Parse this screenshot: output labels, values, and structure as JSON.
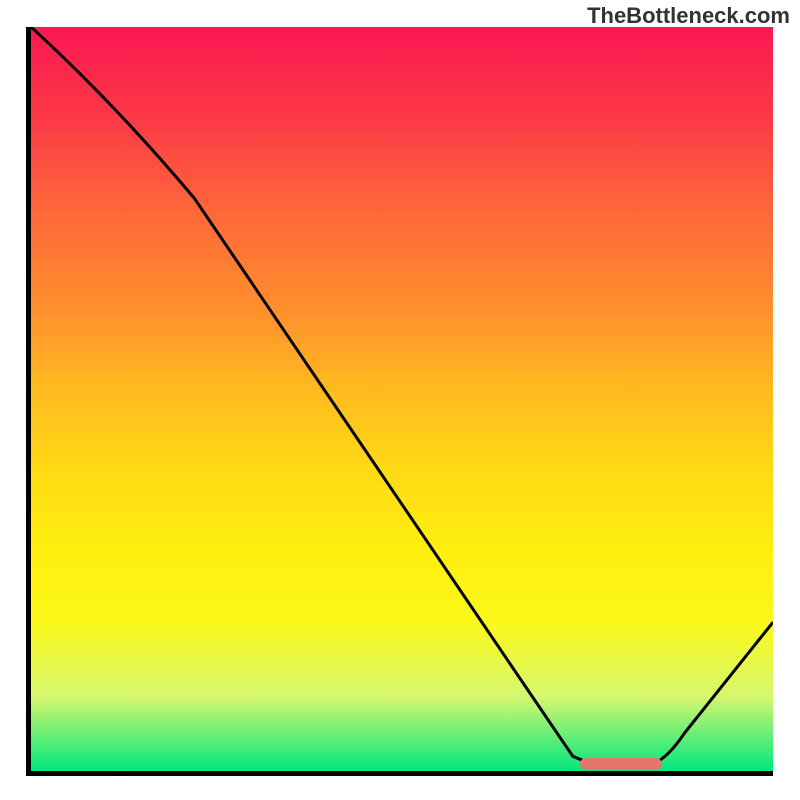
{
  "watermark": "TheBottleneck.com",
  "chart_data": {
    "type": "line",
    "title": "",
    "xlabel": "",
    "ylabel": "",
    "xlim": [
      0,
      100
    ],
    "ylim": [
      0,
      100
    ],
    "curve_points": [
      {
        "x": 0,
        "y": 100
      },
      {
        "x": 22,
        "y": 77
      },
      {
        "x": 73,
        "y": 2
      },
      {
        "x": 80,
        "y": 1
      },
      {
        "x": 84,
        "y": 1
      },
      {
        "x": 100,
        "y": 20
      }
    ],
    "marker_range": {
      "x_start": 74,
      "x_end": 85,
      "y": 1
    },
    "gradient_colors": {
      "top": "#fa1852",
      "bottom": "#00e77f"
    }
  }
}
